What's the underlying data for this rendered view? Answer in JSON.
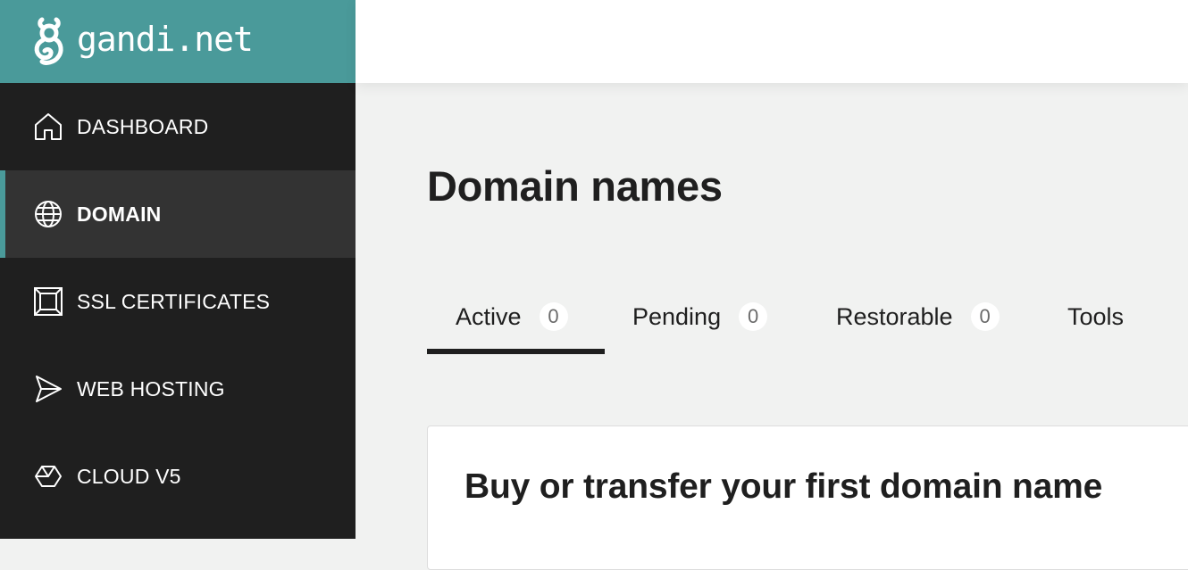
{
  "brand": {
    "name": "gandi.net",
    "color": "#4a9a9a"
  },
  "sidebar": {
    "items": [
      {
        "label": "DASHBOARD",
        "icon": "home-icon",
        "active": false
      },
      {
        "label": "DOMAIN",
        "icon": "globe-icon",
        "active": true
      },
      {
        "label": "SSL CERTIFICATES",
        "icon": "certificate-box-icon",
        "active": false
      },
      {
        "label": "WEB HOSTING",
        "icon": "paper-plane-icon",
        "active": false
      },
      {
        "label": "CLOUD V5",
        "icon": "hexagon-icon",
        "active": false
      }
    ]
  },
  "main": {
    "title": "Domain names",
    "tabs": [
      {
        "label": "Active",
        "count": "0",
        "active": true
      },
      {
        "label": "Pending",
        "count": "0",
        "active": false
      },
      {
        "label": "Restorable",
        "count": "0",
        "active": false
      },
      {
        "label": "Tools",
        "active": false
      }
    ],
    "card": {
      "title": "Buy or transfer your first domain name"
    }
  },
  "colors": {
    "sidebar_bg": "#1f1f1f",
    "sidebar_active_bg": "#333333",
    "accent": "#4a9a9a",
    "page_bg": "#f1f2f1"
  }
}
